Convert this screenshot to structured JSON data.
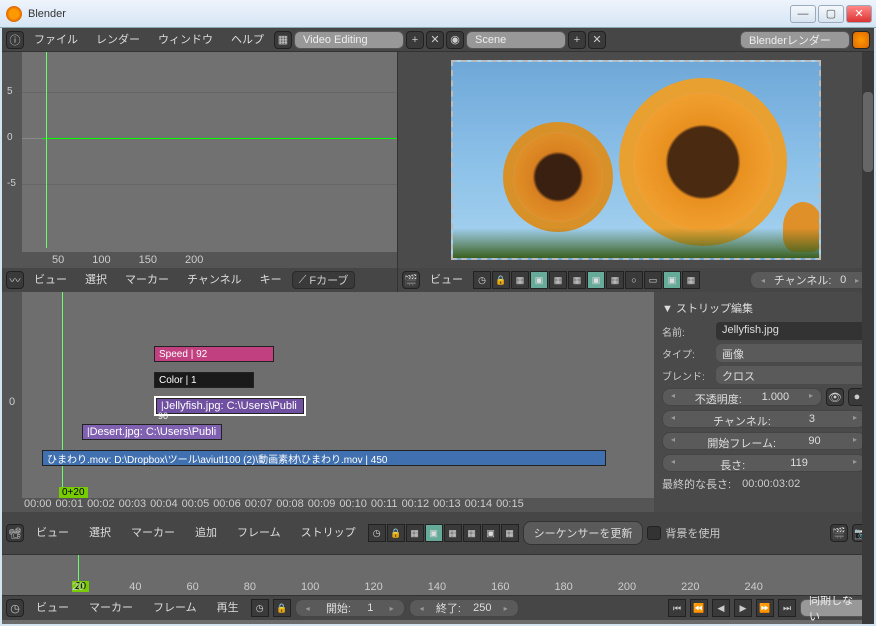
{
  "window": {
    "title": "Blender"
  },
  "topmenu": {
    "file": "ファイル",
    "render": "レンダー",
    "window": "ウィンドウ",
    "help": "ヘルプ"
  },
  "layout_selector": "Video Editing",
  "scene_selector": "Scene",
  "renderer": "Blenderレンダー",
  "graph": {
    "ticks_y": [
      "5",
      "0",
      "-5"
    ],
    "ticks_x": [
      "50",
      "100",
      "150",
      "200"
    ],
    "frame": "20"
  },
  "graph_header": {
    "view": "ビュー",
    "select": "選択",
    "marker": "マーカー",
    "channel": "チャンネル",
    "key": "キー",
    "fcurve": "Fカーブ"
  },
  "preview_header": {
    "view": "ビュー",
    "channel_label": "チャンネル:",
    "channel_val": "0"
  },
  "strips": {
    "speed": "Speed | 92",
    "color": "Color | 1",
    "jelly": "Jellyfish.jpg: C:\\Users\\Publi",
    "jelly_frame": "90",
    "desert": "Desert.jpg: C:\\Users\\Publi",
    "mov": "ひまわり.mov: D:\\Dropbox\\ツール\\aviutl100 (2)\\動画素材\\ひまわり.mov | 450"
  },
  "seq": {
    "frame": "0+20",
    "channel_label": "0"
  },
  "seq_ruler": [
    "00:00",
    "00:01",
    "00:02",
    "00:03",
    "00:04",
    "00:05",
    "00:06",
    "00:07",
    "00:08",
    "00:09",
    "00:10",
    "00:11",
    "00:12",
    "00:13",
    "00:14",
    "00:15"
  ],
  "props": {
    "header": "▼ ストリップ編集",
    "name_lbl": "名前:",
    "name_val": "Jellyfish.jpg",
    "type_lbl": "タイプ:",
    "type_val": "画像",
    "blend_lbl": "ブレンド:",
    "blend_val": "クロス",
    "opacity_lbl": "不透明度:",
    "opacity_val": "1.000",
    "chan_lbl": "チャンネル:",
    "chan_val": "3",
    "start_lbl": "開始フレーム:",
    "start_val": "90",
    "len_lbl": "長さ:",
    "len_val": "119",
    "final_lbl": "最終的な長さ:",
    "final_val": "00:00:03:02"
  },
  "seq_header": {
    "view": "ビュー",
    "select": "選択",
    "marker": "マーカー",
    "add": "追加",
    "frame": "フレーム",
    "strip": "ストリップ",
    "refresh": "シーケンサーを更新",
    "bg": "背景を使用"
  },
  "mini": {
    "frame": "20",
    "ticks": [
      "20",
      "40",
      "60",
      "80",
      "100",
      "120",
      "140",
      "160",
      "180",
      "200",
      "220",
      "240"
    ]
  },
  "timeline_header": {
    "view": "ビュー",
    "marker": "マーカー",
    "frame": "フレーム",
    "play": "再生",
    "start_lbl": "開始:",
    "start_val": "1",
    "end_lbl": "終了:",
    "end_val": "250",
    "sync": "同期しない"
  }
}
